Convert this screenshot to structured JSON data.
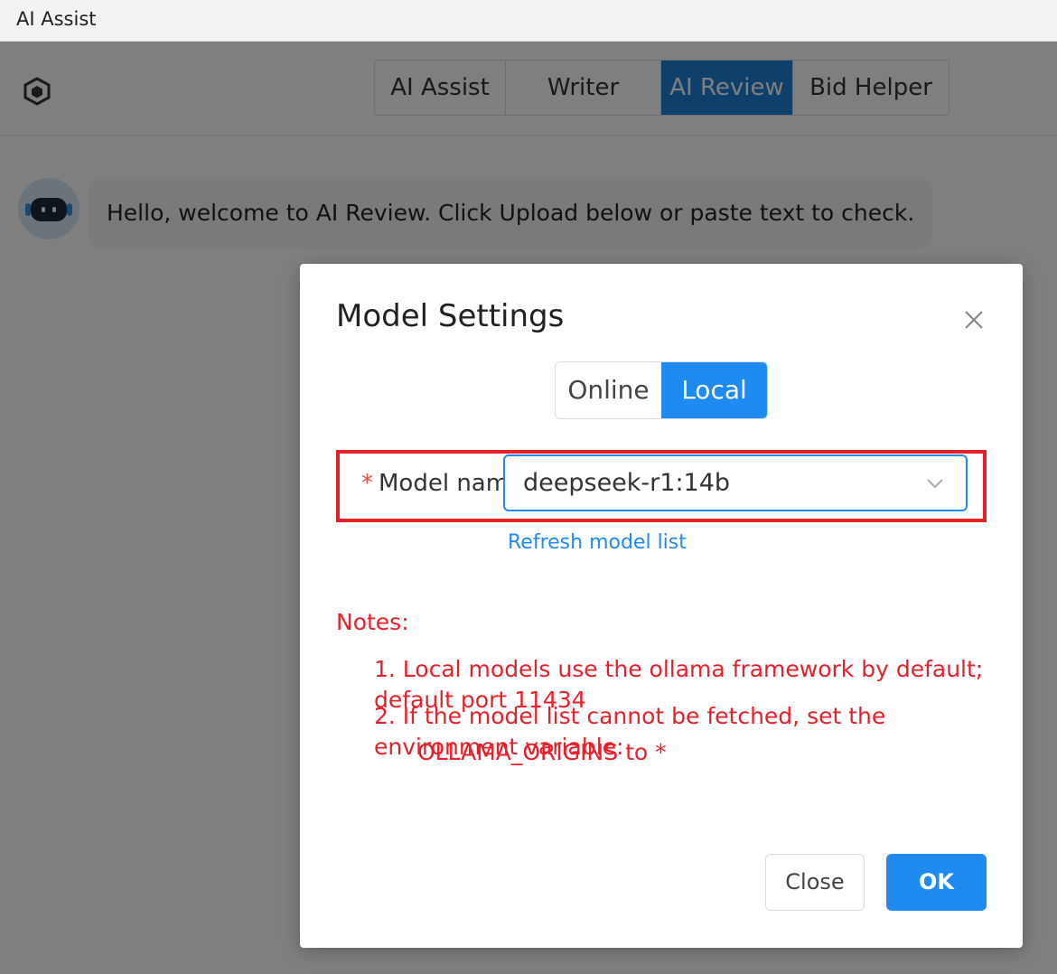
{
  "window": {
    "title": "AI Assist"
  },
  "header": {
    "tabs": [
      {
        "label": "AI Assist",
        "active": false
      },
      {
        "label": "Writer",
        "active": false
      },
      {
        "label": "AI Review",
        "active": true
      },
      {
        "label": "Bid Helper",
        "active": false
      }
    ]
  },
  "chat": {
    "welcome": "Hello, welcome to AI Review. Click Upload below or paste text to check."
  },
  "dialog": {
    "title": "Model Settings",
    "segments": [
      {
        "label": "Online",
        "active": false
      },
      {
        "label": "Local",
        "active": true
      }
    ],
    "field_required_mark": "*",
    "field_label": "Model name:",
    "model_value": "deepseek-r1:14b",
    "refresh_link": "Refresh model list",
    "notes_title": "Notes:",
    "note1": "1. Local models use the ollama framework by default; default port 11434",
    "note2": "2. If the model list cannot be fetched, set the environment variable:",
    "note2_cont": "OLLAMA_ORIGINS to *",
    "close_button": "Close",
    "ok_button": "OK"
  },
  "colors": {
    "primary": "#1f8bf0",
    "tab_active": "#1f7ed6",
    "warning_red": "#e8202a"
  }
}
